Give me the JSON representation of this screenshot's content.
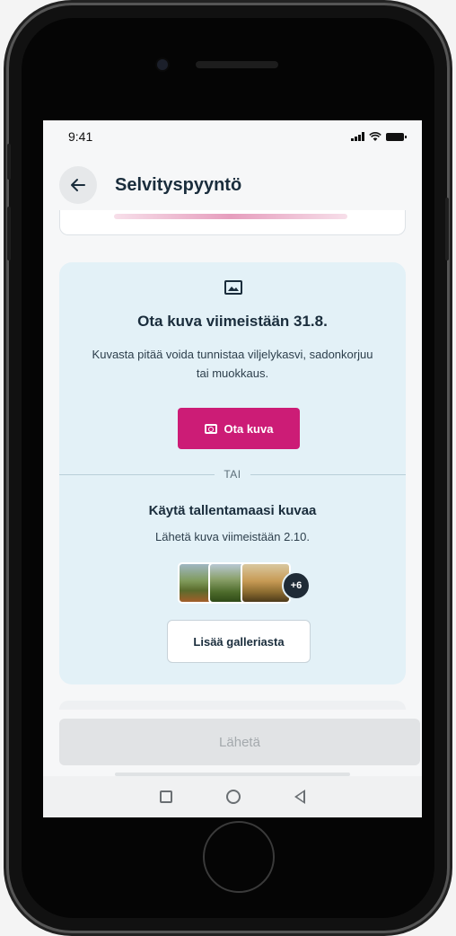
{
  "status_bar": {
    "time": "9:41",
    "icons": [
      "signal-icon",
      "wifi-icon",
      "battery-icon"
    ]
  },
  "header": {
    "back_icon": "arrow-left-icon",
    "title": "Selvityspyyntö"
  },
  "photo_card": {
    "icon": "image-icon",
    "title": "Ota kuva viimeistään 31.8.",
    "description": "Kuvasta pitää voida tunnistaa viljelykasvi, sadonkorjuu tai muokkaus.",
    "take_photo_label": "Ota kuva",
    "take_photo_icon": "camera-icon",
    "divider_text": "TAI",
    "gallery_title": "Käytä tallentamaasi kuvaa",
    "gallery_description": "Lähetä kuva viimeistään 2.10.",
    "more_count": "+6",
    "add_from_gallery_label": "Lisää galleriasta"
  },
  "footer": {
    "send_label": "Lähetä"
  },
  "nav": {
    "icons": [
      "recent-apps-icon",
      "home-icon",
      "back-icon"
    ]
  },
  "colors": {
    "primary": "#cc1c76",
    "card_background": "#e3f1f7",
    "text_dark": "#1a2d3c",
    "disabled_button": "#e1e3e5"
  }
}
